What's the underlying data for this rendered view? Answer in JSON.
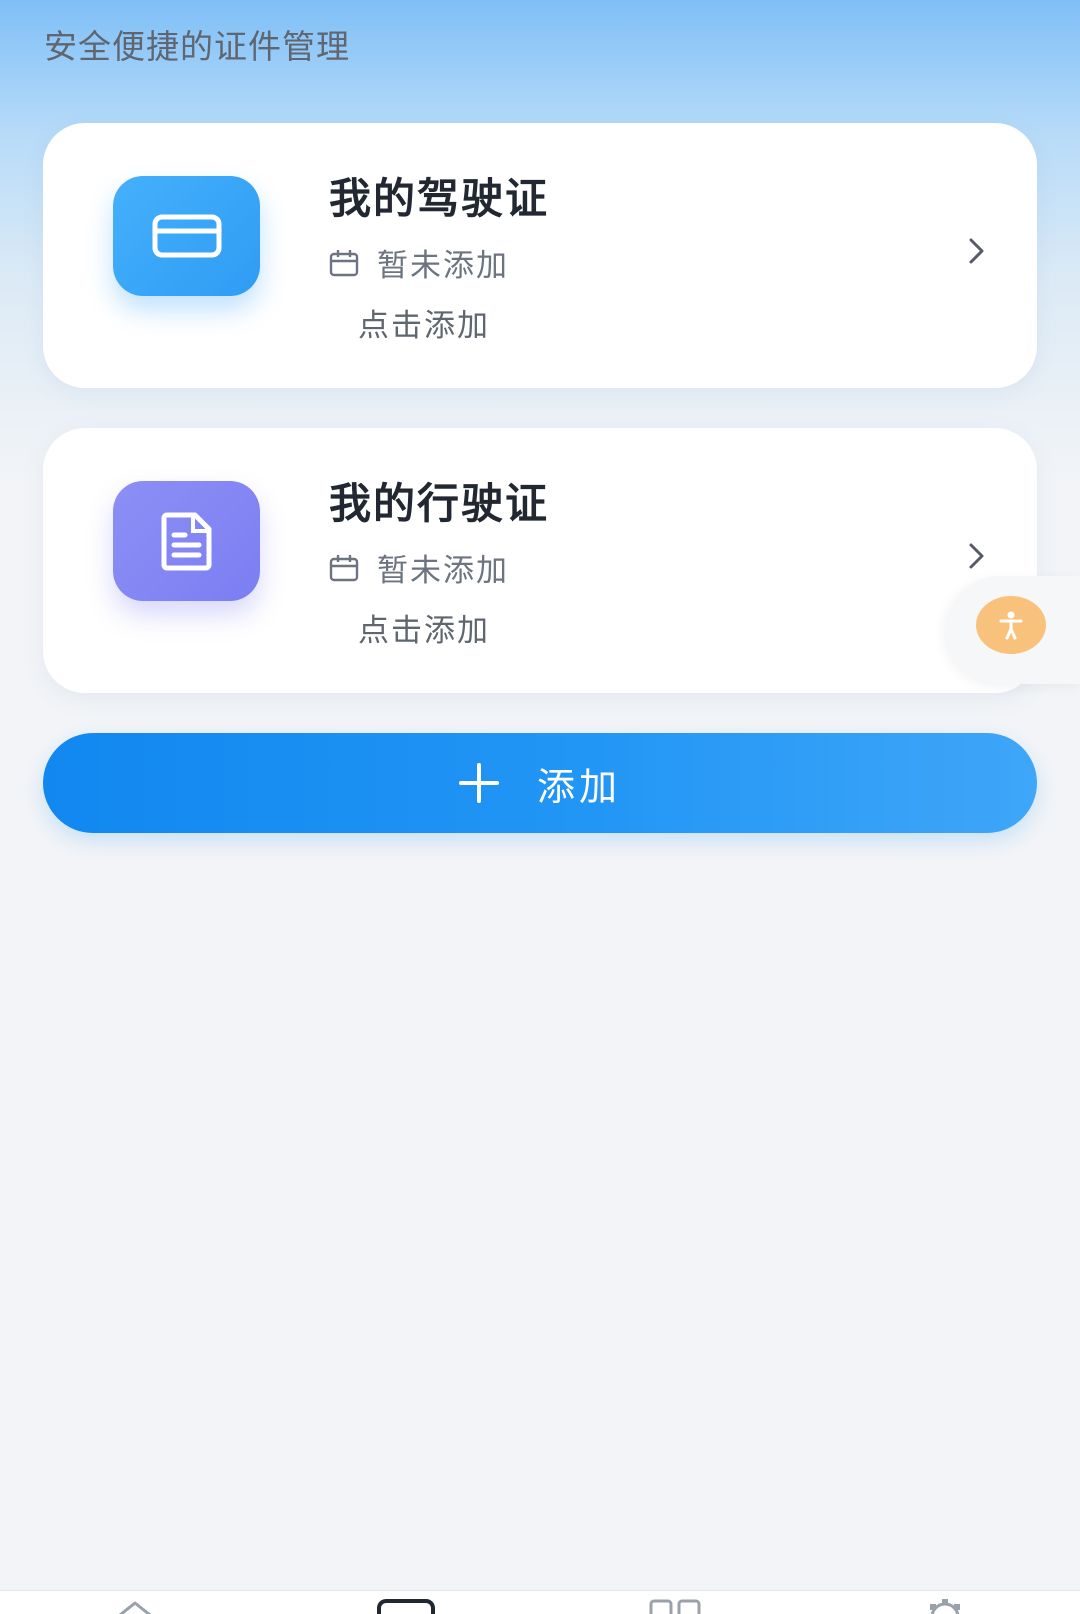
{
  "header": {
    "subtitle": "安全便捷的证件管理"
  },
  "cards": [
    {
      "title": "我的驾驶证",
      "status": "暂未添加",
      "hint": "点击添加",
      "icon": "credit-card-icon",
      "icon_color": "#3aa6f8"
    },
    {
      "title": "我的行驶证",
      "status": "暂未添加",
      "hint": "点击添加",
      "icon": "document-icon",
      "icon_color": "#8385f4"
    }
  ],
  "add_button": {
    "icon": "plus-icon",
    "label": "添加"
  },
  "floating": {
    "icon": "accessibility-icon",
    "color": "#f9c27c"
  },
  "bottom_nav": {
    "items": [
      {
        "icon": "home-icon"
      },
      {
        "icon": "card-icon"
      },
      {
        "icon": "grid-icon"
      },
      {
        "icon": "settings-icon"
      }
    ]
  },
  "colors": {
    "accent": "#1e90f2",
    "background": "#f2f4f7",
    "header_gradient_top": "#7fbff7"
  }
}
